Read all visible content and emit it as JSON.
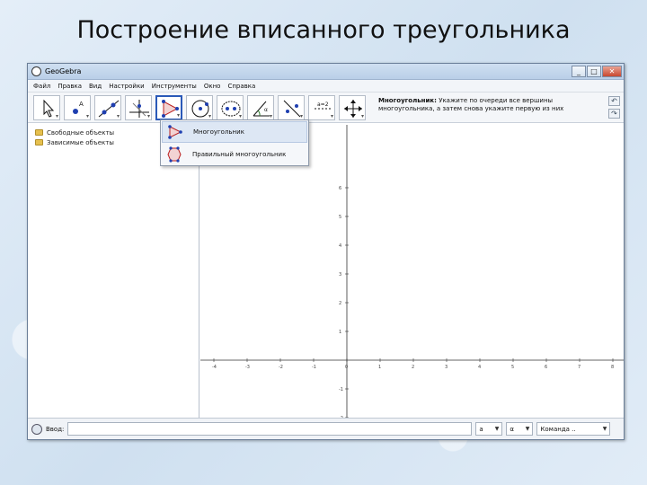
{
  "slide": {
    "title": "Построение вписанного треугольника"
  },
  "window": {
    "title": "GeoGebra",
    "minimize": "_",
    "maximize": "□",
    "close": "✕"
  },
  "menu": [
    "Файл",
    "Правка",
    "Вид",
    "Настройки",
    "Инструменты",
    "Окно",
    "Справка"
  ],
  "toolbar": {
    "tools": [
      {
        "name": "move-tool",
        "icon": "arrow-cursor-icon"
      },
      {
        "name": "point-tool",
        "icon": "point-icon"
      },
      {
        "name": "line-tool",
        "icon": "line-through-points-icon"
      },
      {
        "name": "perpendicular-tool",
        "icon": "perpendicular-line-icon"
      },
      {
        "name": "polygon-tool",
        "icon": "polygon-icon"
      },
      {
        "name": "circle-tool",
        "icon": "circle-center-point-icon"
      },
      {
        "name": "conic-tool",
        "icon": "ellipse-icon"
      },
      {
        "name": "angle-tool",
        "icon": "angle-icon"
      },
      {
        "name": "reflect-tool",
        "icon": "reflect-icon"
      },
      {
        "name": "slider-tool",
        "icon": "slider-icon"
      },
      {
        "name": "move-view-tool",
        "icon": "move-graphics-icon"
      }
    ],
    "help_title": "Многоугольник:",
    "help_text": "Укажите по очереди все вершины многоугольника, а затем снова укажите первую из них"
  },
  "algebra": {
    "items": [
      "Свободные объекты",
      "Зависимые объекты"
    ]
  },
  "dropdown": {
    "items": [
      "Многоугольник",
      "Правильный многоугольник"
    ]
  },
  "graphics": {
    "x_ticks": [
      -4,
      -3,
      -2,
      -1,
      0,
      1,
      2,
      3,
      4,
      5,
      6,
      7,
      8
    ],
    "y_ticks": [
      5,
      4,
      3,
      2,
      1,
      -1,
      -2,
      -3
    ],
    "y_tick_top": 6
  },
  "inputbar": {
    "label": "Ввод:",
    "value": "",
    "select_a": "a",
    "select_b": "α",
    "command": "Команда .."
  },
  "colors": {
    "active_tool_border": "#2a59b8",
    "folder": "#e6c04e",
    "point_blue": "#1f3fb0"
  }
}
